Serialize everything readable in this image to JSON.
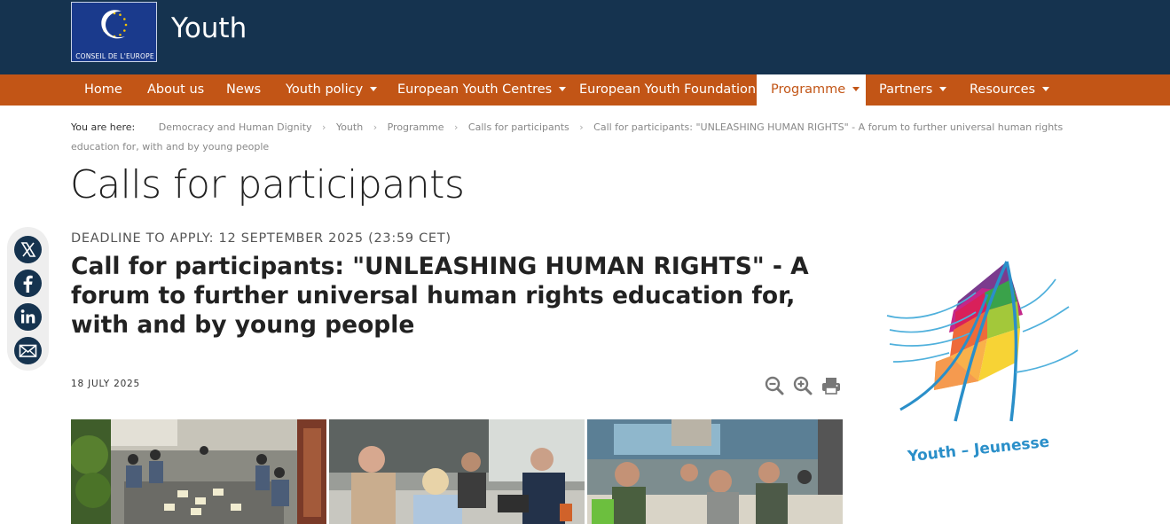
{
  "header": {
    "logo_text": "CONSEIL DE L'EUROPE",
    "site_title": "Youth",
    "background_color": "#15334f"
  },
  "nav": {
    "background_color": "#c25516",
    "items": [
      {
        "label": "Home",
        "has_dropdown": false
      },
      {
        "label": "About us",
        "has_dropdown": false
      },
      {
        "label": "News",
        "has_dropdown": false
      },
      {
        "label": "Youth policy",
        "has_dropdown": true
      },
      {
        "label": "European Youth Centres",
        "has_dropdown": true
      },
      {
        "label": "European Youth Foundation",
        "has_dropdown": false
      },
      {
        "label": "Programme",
        "has_dropdown": true,
        "active": true
      },
      {
        "label": "Partners",
        "has_dropdown": true
      },
      {
        "label": "Resources",
        "has_dropdown": true
      }
    ]
  },
  "breadcrumb": {
    "lead": "You are here:",
    "items": [
      "Democracy and Human Dignity",
      "Youth",
      "Programme",
      "Calls for participants",
      "Call for participants: \"UNLEASHING HUMAN RIGHTS\" -  A forum to further universal human rights education for, with and by young people"
    ]
  },
  "page_title": "Calls for participants",
  "article": {
    "deadline": "DEADLINE TO APPLY: 12 SEPTEMBER 2025 (23:59 CET)",
    "title": "Call for participants: \"UNLEASHING HUMAN RIGHTS\" -  A forum to further universal human rights education for, with and by young people",
    "date": "18 JULY 2025"
  },
  "tools": [
    {
      "icon": "zoom-out-icon"
    },
    {
      "icon": "zoom-in-icon"
    },
    {
      "icon": "print-icon"
    }
  ],
  "share": [
    {
      "icon": "x-twitter-icon"
    },
    {
      "icon": "facebook-icon"
    },
    {
      "icon": "linkedin-icon"
    },
    {
      "icon": "email-icon"
    }
  ],
  "side_logo": {
    "caption": "Youth – Jeunesse"
  }
}
